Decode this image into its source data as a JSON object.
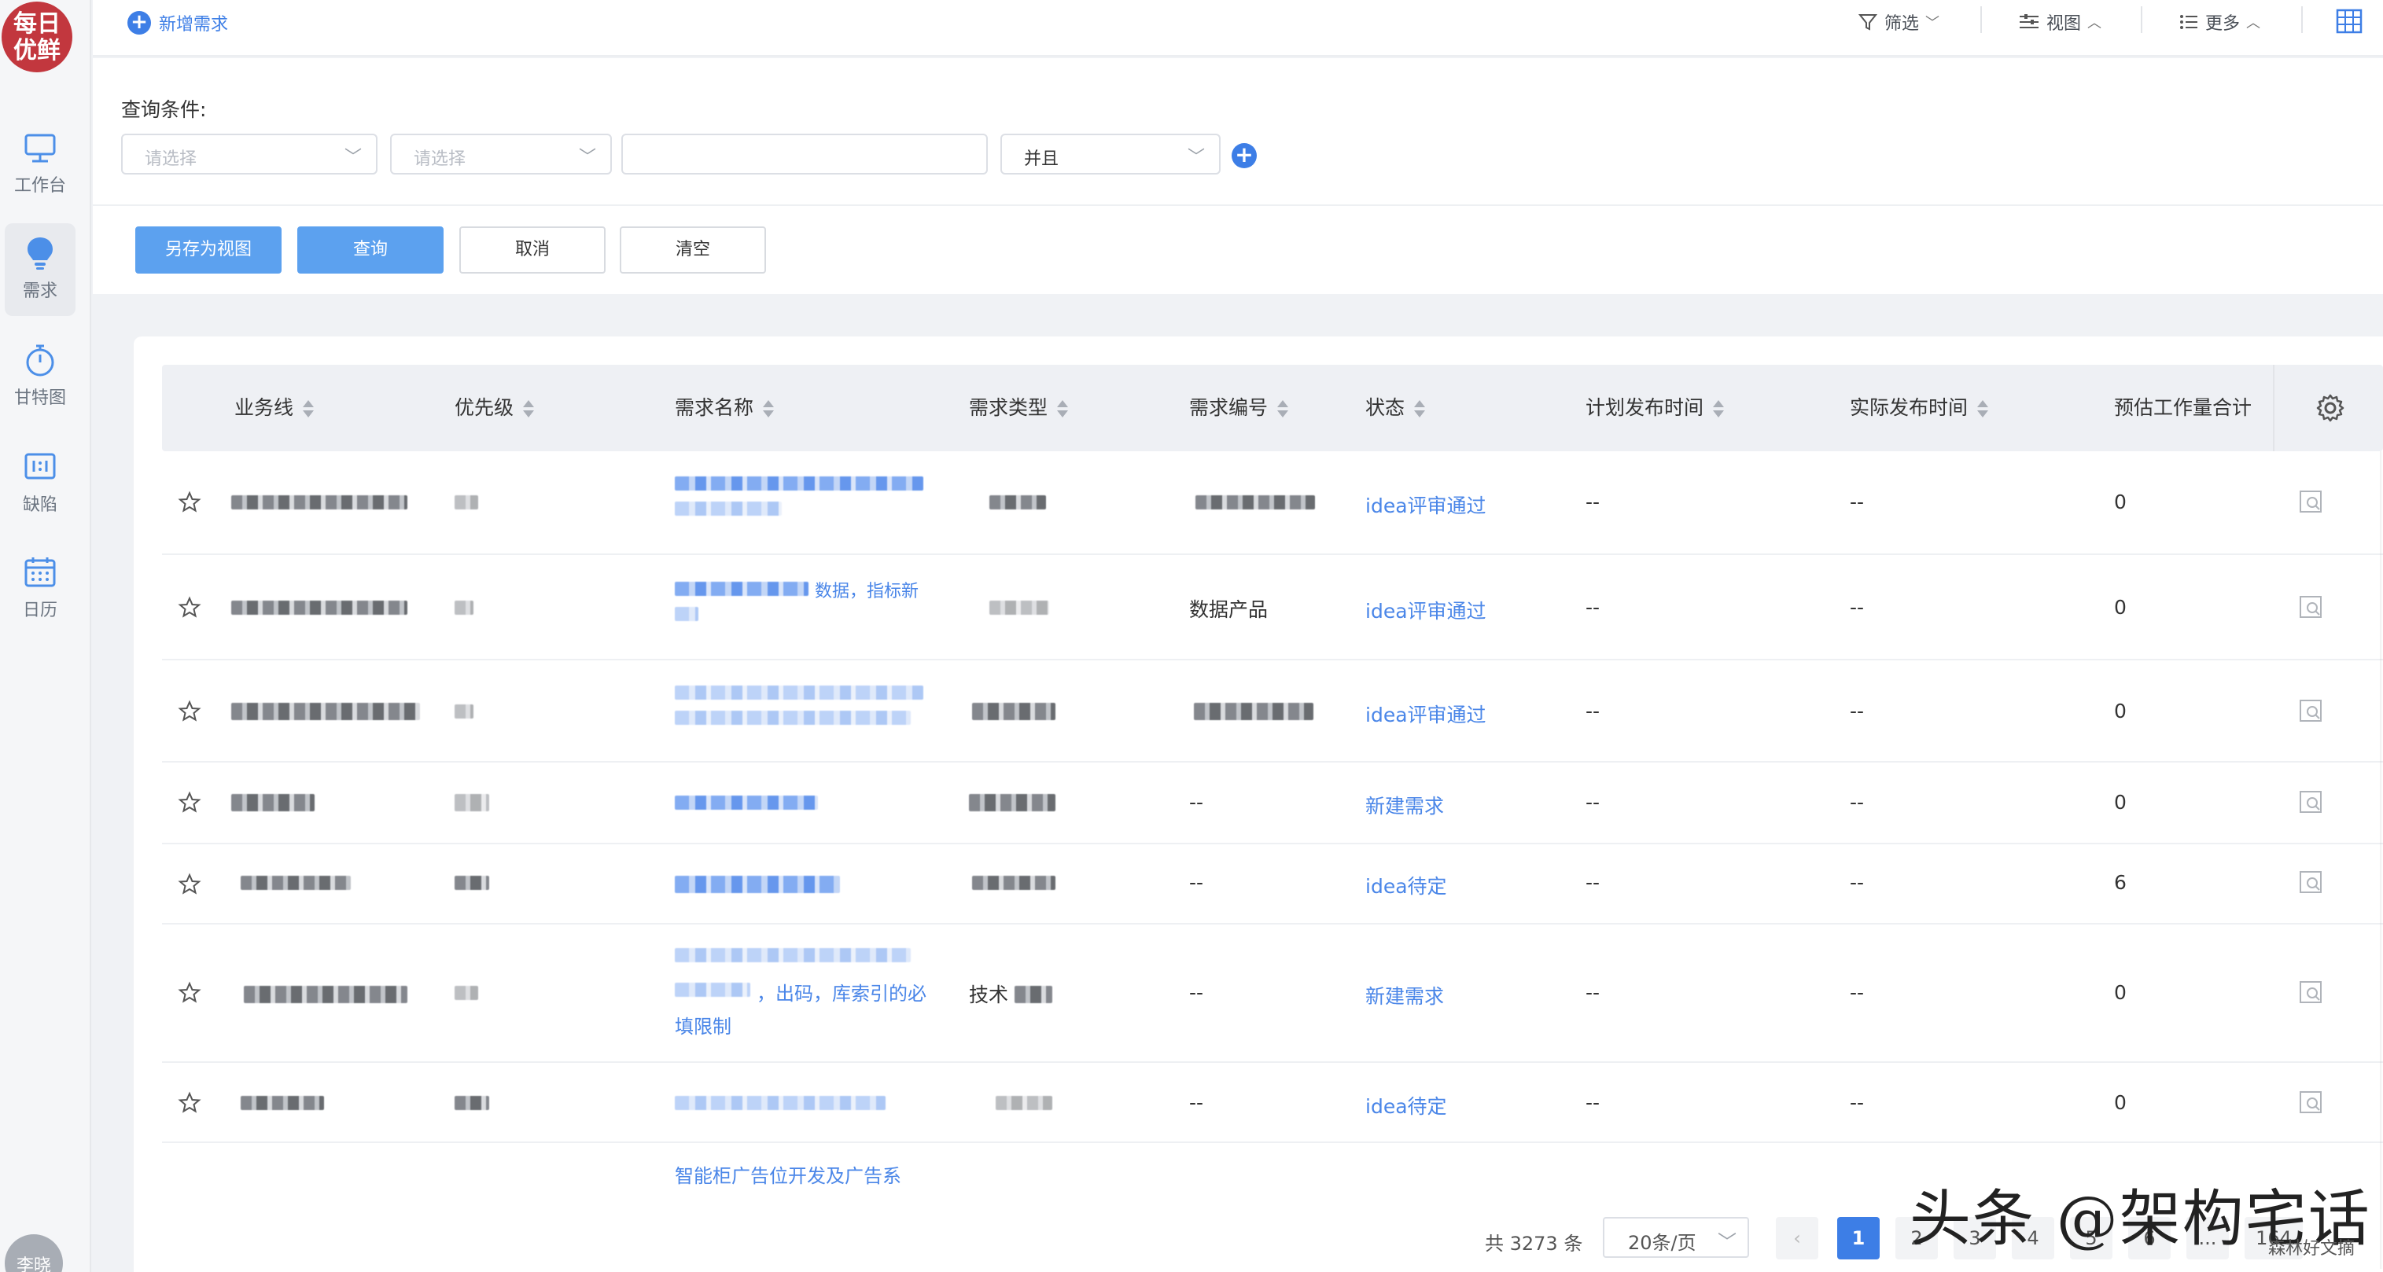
{
  "sidebar": {
    "logo_text_line1": "每日",
    "logo_text_line2": "优鲜",
    "items": [
      {
        "label": "工作台",
        "icon": "monitor-icon"
      },
      {
        "label": "需求",
        "icon": "lightbulb-icon",
        "active": true
      },
      {
        "label": "甘特图",
        "icon": "stopwatch-icon"
      },
      {
        "label": "缺陷",
        "icon": "defect-icon"
      },
      {
        "label": "日历",
        "icon": "calendar-icon"
      }
    ],
    "avatar_text": "李晓"
  },
  "toolbar": {
    "new_requirement": "新增需求",
    "filter": "筛选",
    "view": "视图",
    "more": "更多"
  },
  "query": {
    "label": "查询条件:",
    "select1_placeholder": "请选择",
    "select2_placeholder": "请选择",
    "text_value": "",
    "logic_value": "并且",
    "buttons": {
      "save_view": "另存为视图",
      "search": "查询",
      "cancel": "取消",
      "clear": "清空"
    }
  },
  "table": {
    "columns": [
      "业务线",
      "优先级",
      "需求名称",
      "需求类型",
      "需求编号",
      "状态",
      "计划发布时间",
      "实际发布时间",
      "预估工作量合计"
    ],
    "rows": [
      {
        "status": "idea评审通过",
        "plan_time": "--",
        "actual_time": "--",
        "estimate": "0",
        "req_no": ""
      },
      {
        "status": "idea评审通过",
        "plan_time": "--",
        "actual_time": "--",
        "estimate": "0",
        "req_no": "数据产品",
        "name_tail": "数据，指标新"
      },
      {
        "status": "idea评审通过",
        "plan_time": "--",
        "actual_time": "--",
        "estimate": "0",
        "req_no": ""
      },
      {
        "status": "新建需求",
        "plan_time": "--",
        "actual_time": "--",
        "estimate": "0",
        "req_no": "--"
      },
      {
        "status": "idea待定",
        "plan_time": "--",
        "actual_time": "--",
        "estimate": "6",
        "req_no": "--"
      },
      {
        "status": "新建需求",
        "plan_time": "--",
        "actual_time": "--",
        "estimate": "0",
        "req_no": "--",
        "name_line2": "，出码，库索引的必",
        "name_line3": "填限制",
        "type_text": "技术"
      },
      {
        "status": "idea待定",
        "plan_time": "--",
        "actual_time": "--",
        "estimate": "0",
        "req_no": "--"
      }
    ],
    "partial_row_name": "智能柜广告位开发及广告系"
  },
  "pagination": {
    "total": "共 3273 条",
    "page_size": "20条/页",
    "pages": [
      "1",
      "2",
      "3",
      "4",
      "5",
      "6",
      "...",
      "164"
    ],
    "current": "1"
  },
  "watermark": {
    "main": "头条 @架构宅话",
    "sub": "森林好文摘"
  },
  "colors": {
    "accent": "#3d7ee6",
    "primary_button": "#5ca1ef",
    "link": "#4a86e8",
    "brand": "#c2373e"
  }
}
